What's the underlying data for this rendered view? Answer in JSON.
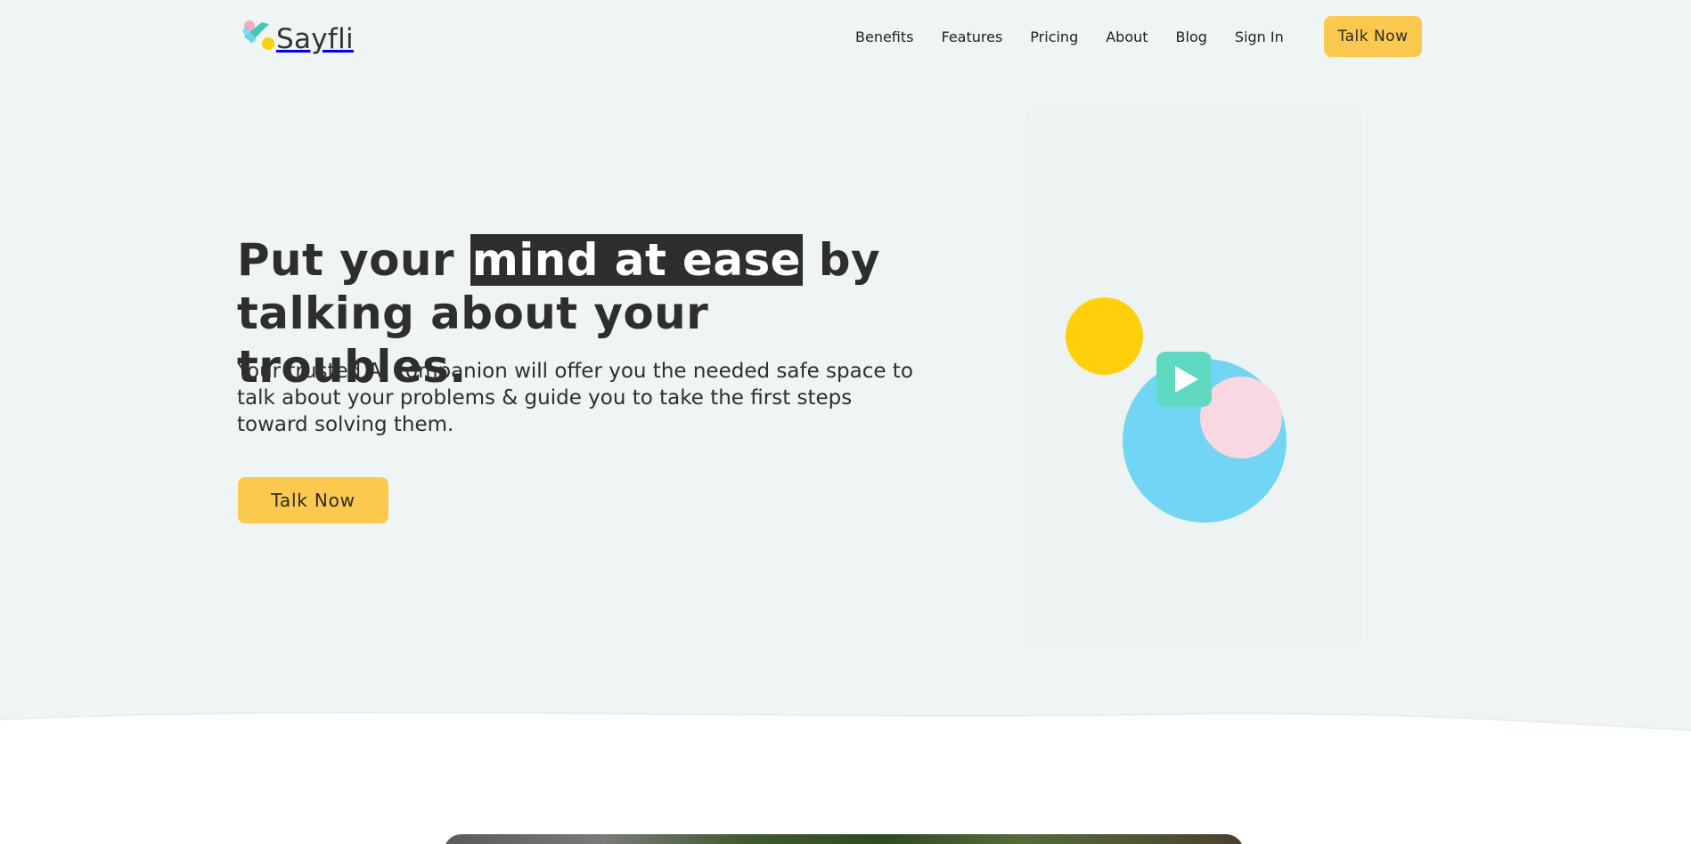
{
  "brand": {
    "name": "Sayfli"
  },
  "nav": {
    "items": [
      {
        "label": "Benefits"
      },
      {
        "label": "Features"
      },
      {
        "label": "Pricing"
      },
      {
        "label": "About"
      },
      {
        "label": "Blog"
      },
      {
        "label": "Sign In"
      }
    ],
    "cta_label": "Talk Now"
  },
  "hero": {
    "headline_before": "Put your ",
    "headline_highlight": "mind at ease",
    "headline_after": " by talking about your troubles.",
    "subtext": "Your trusted AI companion will offer you the needed safe space to talk about your problems & guide you to take the first steps toward solving them.",
    "cta_label": "Talk Now"
  },
  "illustration": {
    "play_icon": "play-icon"
  },
  "colors": {
    "accent_yellow": "#fbc94d",
    "hero_background": "#eef5f4",
    "text_dark": "#2e2e2e",
    "circle_yellow": "#fecf0b",
    "circle_blue": "#72d5f3",
    "circle_pink": "#fad8e1",
    "play_teal": "#60d9c3"
  }
}
